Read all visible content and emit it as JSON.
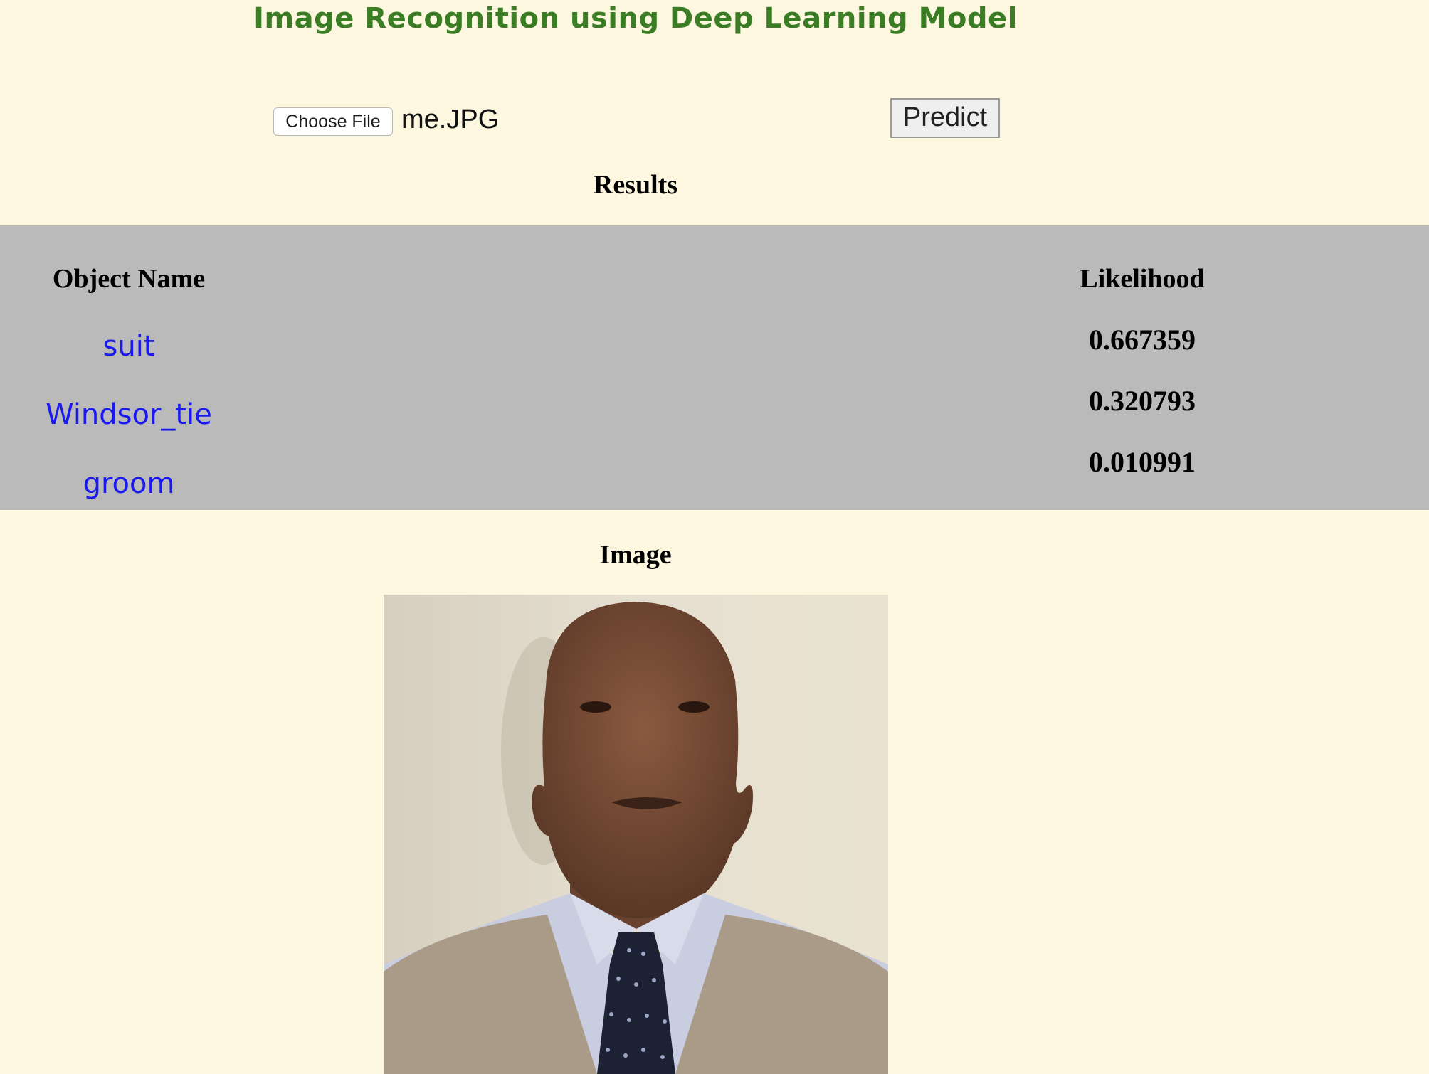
{
  "page": {
    "title": "Image Recognition using Deep Learning Model"
  },
  "upload": {
    "choose_file_label": "Choose File",
    "file_name": "me.JPG",
    "predict_label": "Predict"
  },
  "results": {
    "heading": "Results",
    "columns": {
      "object_name": "Object Name",
      "likelihood": "Likelihood"
    },
    "rows": [
      {
        "name": "suit",
        "likelihood": "0.667359"
      },
      {
        "name": "Windsor_tie",
        "likelihood": "0.320793"
      },
      {
        "name": "groom",
        "likelihood": "0.010991"
      }
    ]
  },
  "image_section": {
    "heading": "Image"
  },
  "colors": {
    "background": "#fdf7e0",
    "title": "#3a7d25",
    "results_band": "#bababa",
    "object_name_text": "#1a1af0"
  }
}
